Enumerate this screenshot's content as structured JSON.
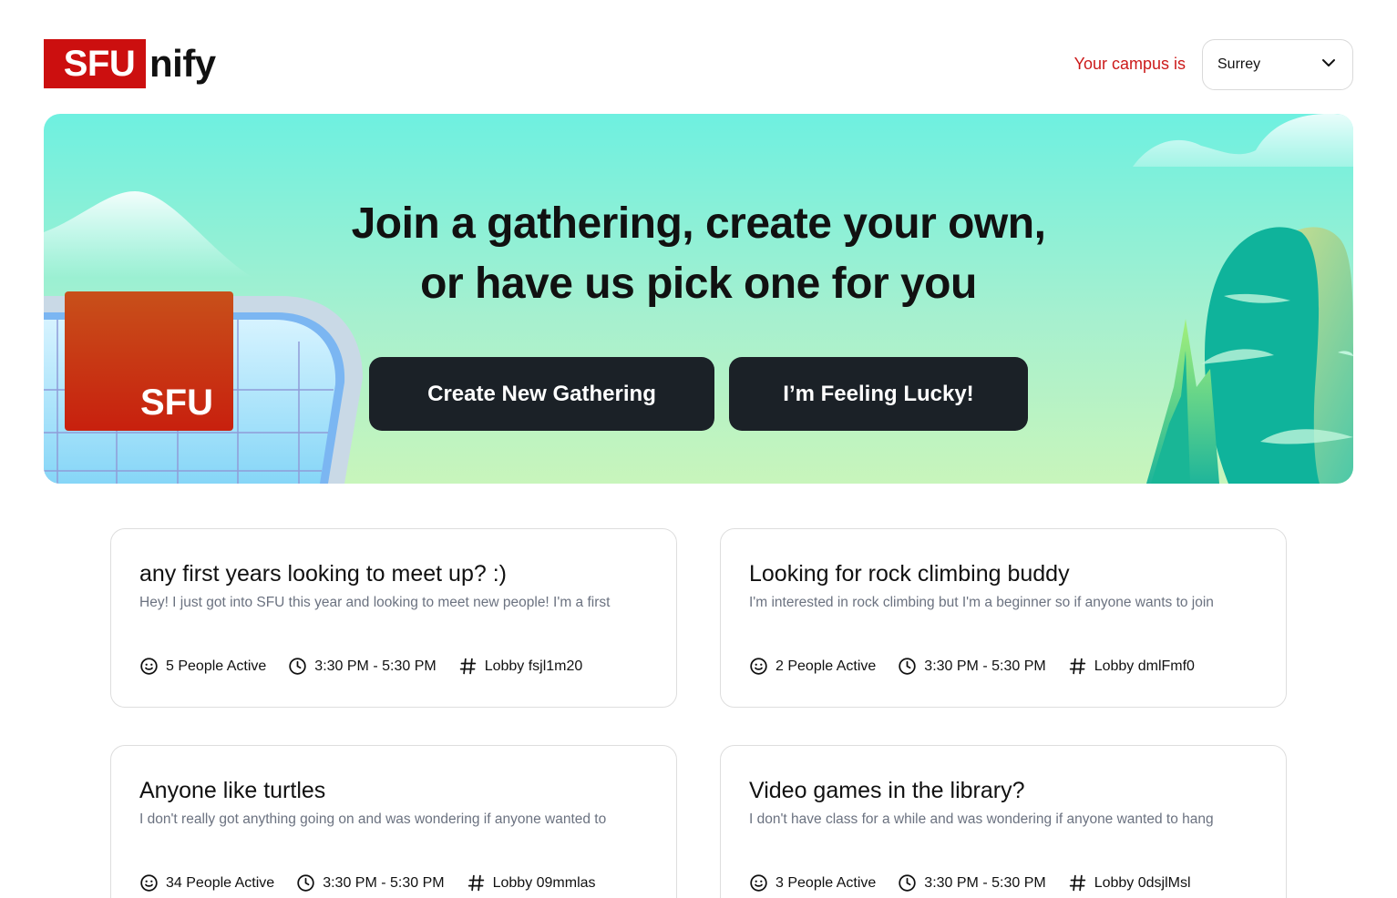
{
  "brand": {
    "logo_boxed": "SFU",
    "logo_rest": "nify",
    "color": "#cc0f0f"
  },
  "campus": {
    "label": "Your campus is",
    "selected": "Surrey"
  },
  "hero": {
    "title_line1": "Join a gathering, create your own,",
    "title_line2": "or have us pick one for you",
    "create_button": "Create New Gathering",
    "lucky_button": "I’m Feeling Lucky!",
    "sign_text": "SFU"
  },
  "gatherings": [
    {
      "title": "any first years looking to meet up? :)",
      "description": "Hey! I just got into SFU this year and looking to meet new people! I'm a first",
      "active": "5 People Active",
      "time": "3:30 PM - 5:30 PM",
      "lobby": "Lobby fsjl1m20"
    },
    {
      "title": "Looking for rock climbing buddy",
      "description": "I'm interested in rock climbing but I'm a beginner so if anyone wants to join",
      "active": "2 People Active",
      "time": "3:30 PM - 5:30 PM",
      "lobby": "Lobby dmlFmf0"
    },
    {
      "title": "Anyone like turtles",
      "description": "I don't really got anything going on and was wondering if anyone wanted to",
      "active": "34 People Active",
      "time": "3:30 PM - 5:30 PM",
      "lobby": "Lobby 09mmlas"
    },
    {
      "title": "Video games in the library?",
      "description": "I don't have class for a while and was wondering if anyone wanted to hang",
      "active": "3 People Active",
      "time": "3:30 PM - 5:30 PM",
      "lobby": "Lobby 0dsjlMsl"
    }
  ],
  "icons": {
    "people": "smiley-icon",
    "time": "clock-icon",
    "lobby": "hash-icon",
    "dropdown": "chevron-down-icon"
  }
}
